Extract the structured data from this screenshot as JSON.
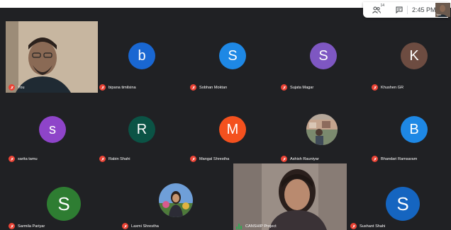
{
  "toolbar": {
    "participants_count": "14",
    "time": "2:45 PM",
    "self_thumb_label": "You",
    "icons": [
      "people-icon",
      "chat-icon"
    ]
  },
  "participants": [
    {
      "name": "You",
      "kind": "video"
    },
    {
      "name": "bipana timilsina",
      "initial": "b",
      "color": "#1967d2"
    },
    {
      "name": "Sobhan Moktan",
      "initial": "S",
      "color": "#1e88e5"
    },
    {
      "name": "Sujata Magar",
      "initial": "S",
      "color": "#7e57c2"
    },
    {
      "name": "Khushen GR",
      "initial": "K",
      "color": "#6d4c41"
    },
    {
      "name": "sarita tamu",
      "initial": "s",
      "color": "#8e44c9"
    },
    {
      "name": "Rabin Shahi",
      "initial": "R",
      "color": "#0b5345"
    },
    {
      "name": "Mangal Shrestha",
      "initial": "M",
      "color": "#f4511e"
    },
    {
      "name": "Ashish Rauniyar",
      "kind": "photo"
    },
    {
      "name": "Bhandari Ramsaram",
      "initial": "B",
      "color": "#1e88e5"
    },
    {
      "name": "Sarmila Pariyar",
      "initial": "S",
      "color": "#2e7d32"
    },
    {
      "name": "Laxmi Shrestha",
      "kind": "photo"
    },
    {
      "name": "CANSHIP Project",
      "kind": "video",
      "speaking": true
    },
    {
      "name": "Sushant Shahi",
      "initial": "S",
      "color": "#1565c0"
    }
  ]
}
